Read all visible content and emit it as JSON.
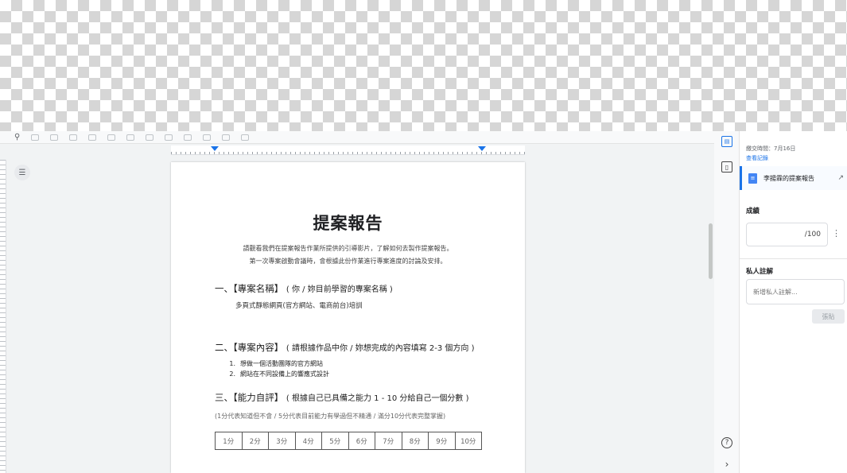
{
  "toolbar": {
    "search_icon": "search-icon"
  },
  "document": {
    "title": "提案報告",
    "intro_line1": "請觀看我們在提案報告作業所提供的引導影片，了解如何去製作提案報告。",
    "intro_line2": "第一次專案啟動會議時，會根據此份作業進行專案進度的討論及安排。",
    "section1": {
      "heading": "一、【專案名稱】",
      "note": "( 你 / 妳目前學習的專案名稱 )",
      "body": "多頁式靜態網頁(官方網站、電商前台)培訓"
    },
    "section2": {
      "heading": "二、【專案內容】",
      "note": "( 請根據作品中你 / 妳想完成的內容填寫 2-3 個方向 )",
      "items": [
        {
          "num": "1.",
          "text": "想做一個活動團隊的官方網站"
        },
        {
          "num": "2.",
          "text": "網站在不同設備上的響應式設計"
        }
      ]
    },
    "section3": {
      "heading": "三、【能力自評】",
      "note": "( 根據自己已具備之能力 1 - 10 分給自己一個分數 )",
      "scale_note": "(1分代表知道但不會 / 5分代表目前能力有學過但不精通 / 滿分10分代表完整掌握)",
      "scores": [
        "1分",
        "2分",
        "3分",
        "4分",
        "5分",
        "6分",
        "7分",
        "8分",
        "9分",
        "10分"
      ]
    }
  },
  "panel": {
    "meta_text": "繳交時間：7月16日",
    "meta_link": "查看記錄",
    "assignment_name": "李揚霖的提案報告",
    "grade_label": "成績",
    "grade_value": "",
    "grade_max": "/100",
    "private_comment_label": "私人註解",
    "private_comment_placeholder": "新增私人註解...",
    "post_button": "張貼"
  },
  "colors": {
    "accent": "#1a73e8",
    "doc_icon": "#4285f4"
  }
}
